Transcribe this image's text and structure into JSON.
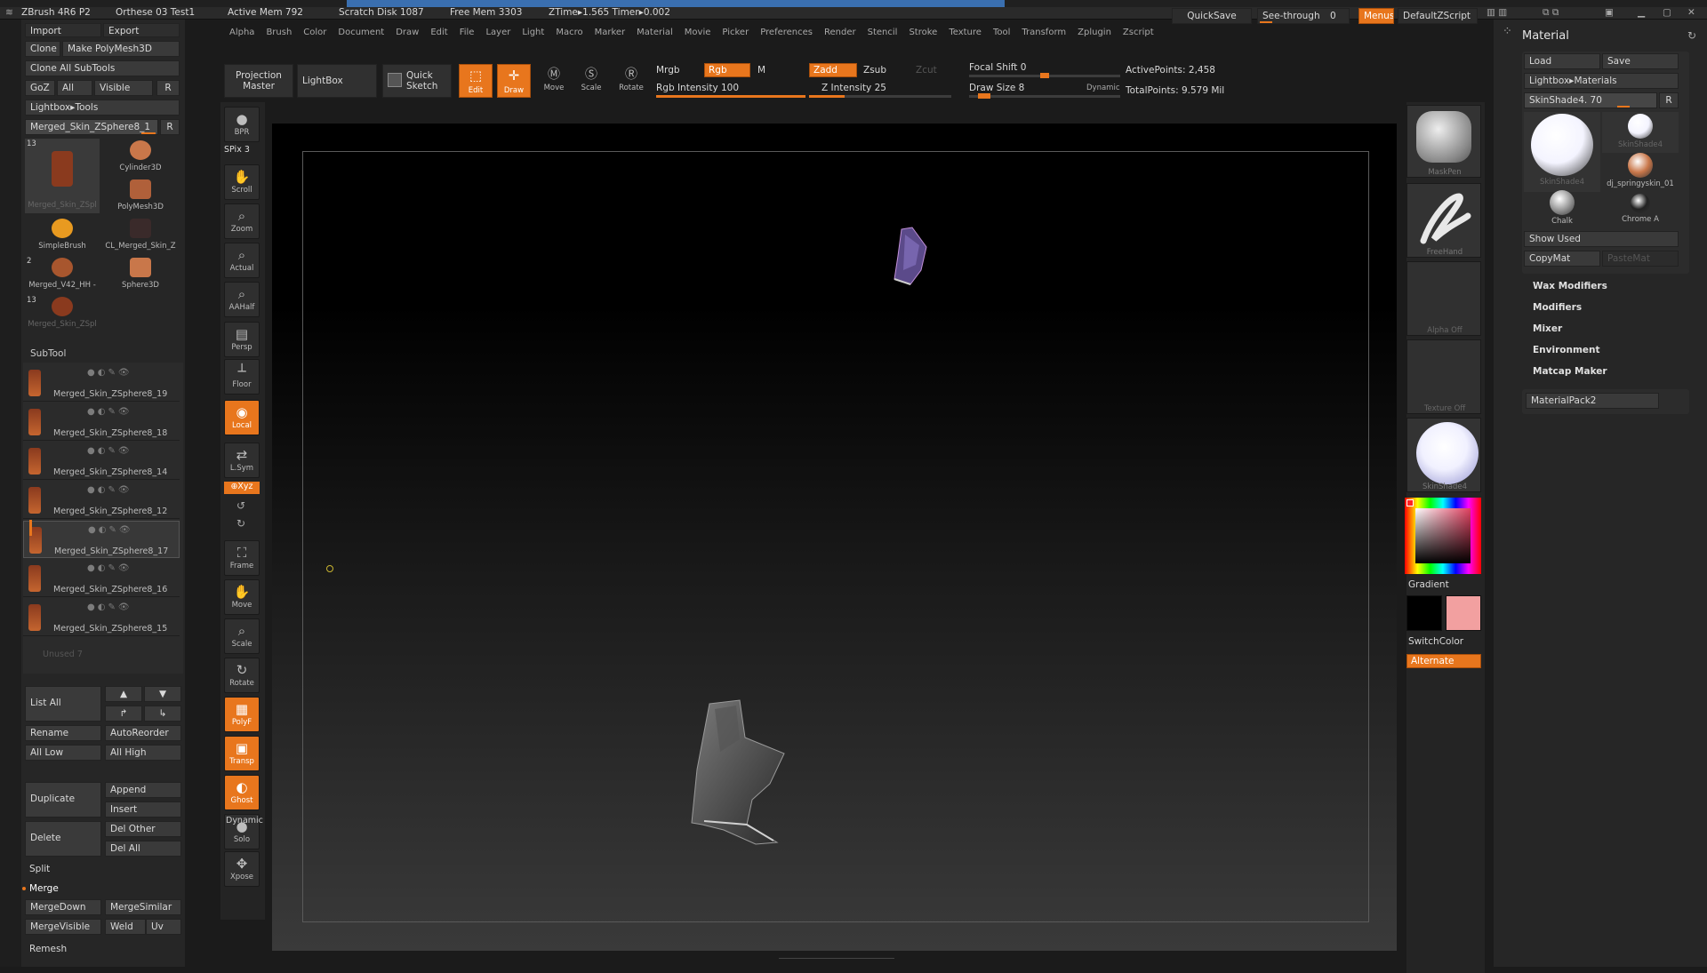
{
  "titlebar": {
    "app": "ZBrush 4R6 P2",
    "document": "Orthese 03 Test1",
    "active_mem": "Active Mem 792",
    "scratch_disk": "Scratch Disk 1087",
    "free_mem": "Free Mem 3303",
    "ztime": "ZTime▸1.565 Timer▸0.002",
    "quicksave": "QuickSave",
    "see_through": "See-through",
    "see_through_value": "0",
    "menus": "Menus",
    "script": "DefaultZScript"
  },
  "menubar": [
    "Alpha",
    "Brush",
    "Color",
    "Document",
    "Draw",
    "Edit",
    "File",
    "Layer",
    "Light",
    "Macro",
    "Marker",
    "Material",
    "Movie",
    "Picker",
    "Preferences",
    "Render",
    "Stencil",
    "Stroke",
    "Texture",
    "Tool",
    "Transform",
    "Zplugin",
    "Zscript"
  ],
  "tool_panel": {
    "import": "Import",
    "export": "Export",
    "clone": "Clone",
    "make_polymesh": "Make PolyMesh3D",
    "clone_all": "Clone All SubTools",
    "goz": "GoZ",
    "all": "All",
    "visible": "Visible",
    "r": "R",
    "lightbox_tools": "Lightbox▸Tools",
    "current_tool": "Merged_Skin_ZSphere8_1",
    "current_r": "R",
    "tools": [
      {
        "name": "Merged_Skin_ZSpl",
        "badge": "13"
      },
      {
        "name": "Cylinder3D",
        "badge": ""
      },
      {
        "name": "PolyMesh3D",
        "badge": ""
      },
      {
        "name": "SimpleBrush",
        "badge": ""
      },
      {
        "name": "CL_Merged_Skin_Z",
        "badge": ""
      },
      {
        "name": "Merged_V42_HH -",
        "badge": "2"
      },
      {
        "name": "Sphere3D",
        "badge": ""
      },
      {
        "name": "Merged_Skin_ZSpl",
        "badge": "13"
      }
    ]
  },
  "subtool": {
    "header": "SubTool",
    "items": [
      "Merged_Skin_ZSphere8_19",
      "Merged_Skin_ZSphere8_18",
      "Merged_Skin_ZSphere8_14",
      "Merged_Skin_ZSphere8_12",
      "Merged_Skin_ZSphere8_17",
      "Merged_Skin_ZSphere8_16",
      "Merged_Skin_ZSphere8_15"
    ],
    "unused": "Unused 7",
    "list_all": "List All",
    "rename": "Rename",
    "autoreorder": "AutoReorder",
    "all_low": "All Low",
    "all_high": "All High",
    "duplicate": "Duplicate",
    "append": "Append",
    "insert": "Insert",
    "delete": "Delete",
    "del_other": "Del Other",
    "del_all": "Del All",
    "split": "Split",
    "merge": "Merge",
    "mergedown": "MergeDown",
    "mergesimilar": "MergeSimilar",
    "mergevisible": "MergeVisible",
    "weld": "Weld",
    "uv": "Uv",
    "remesh": "Remesh"
  },
  "toolbar": {
    "projection_master": "Projection Master",
    "lightbox": "LightBox",
    "quick_sketch": "Quick Sketch",
    "edit": "Edit",
    "draw": "Draw",
    "move": "Move",
    "scale": "Scale",
    "rotate": "Rotate",
    "mrgb": "Mrgb",
    "rgb": "Rgb",
    "m": "M",
    "rgb_intensity": "Rgb Intensity 100",
    "rgb_intensity_value": 100,
    "zadd": "Zadd",
    "zsub": "Zsub",
    "zcut": "Zcut",
    "z_intensity": "Z Intensity 25",
    "z_intensity_value": 25,
    "focal_shift": "Focal Shift 0",
    "focal_shift_value": 0,
    "draw_size": "Draw Size 8",
    "draw_size_value": 8,
    "dynamic": "Dynamic",
    "active_points": "ActivePoints: 2,458",
    "total_points": "TotalPoints: 9.579 Mil"
  },
  "left_shelf": [
    {
      "name": "BPR",
      "glyph": "●",
      "on": false
    },
    {
      "name": "Scroll",
      "glyph": "✋",
      "on": false
    },
    {
      "name": "Zoom",
      "glyph": "⌕",
      "on": false
    },
    {
      "name": "Actual",
      "glyph": "⌕",
      "on": false
    },
    {
      "name": "AAHalf",
      "glyph": "⌕",
      "on": false
    },
    {
      "name": "Persp",
      "glyph": "▤",
      "on": false
    },
    {
      "name": "Floor",
      "glyph": "┴",
      "on": false
    },
    {
      "name": "Local",
      "glyph": "◉",
      "on": true
    },
    {
      "name": "L.Sym",
      "glyph": "⇄",
      "on": false
    },
    {
      "name": "Frame",
      "glyph": "⛶",
      "on": false
    },
    {
      "name": "Move",
      "glyph": "✋",
      "on": false
    },
    {
      "name": "Scale",
      "glyph": "⌕",
      "on": false
    },
    {
      "name": "Rotate",
      "glyph": "↻",
      "on": false
    },
    {
      "name": "PolyF",
      "glyph": "▦",
      "on": true
    },
    {
      "name": "Transp",
      "glyph": "▣",
      "on": true
    },
    {
      "name": "Ghost",
      "glyph": "◐",
      "on": true
    },
    {
      "name": "Solo",
      "glyph": "●",
      "on": false
    },
    {
      "name": "Xpose",
      "glyph": "✥",
      "on": false
    }
  ],
  "left_shelf_extra": {
    "spix": "SPix 3",
    "xyz": "⊕Xyz",
    "dynamic": "Dynamic"
  },
  "right_shelf": {
    "brush": "MaskPen",
    "stroke": "FreeHand",
    "alpha": "Alpha  Off",
    "texture": "Texture  Off",
    "material": "SkinShade4",
    "gradient": "Gradient",
    "switchcolor": "SwitchColor",
    "alternate": "Alternate",
    "main_color": "#000000",
    "secondary_color": "#f2a0a0"
  },
  "material_panel": {
    "title": "Material",
    "load": "Load",
    "save": "Save",
    "lightbox_materials": "Lightbox▸Materials",
    "current": "SkinShade4. 70",
    "r": "R",
    "materials": [
      {
        "name": "SkinShade4",
        "color": "#f4f4ff"
      },
      {
        "name": "SkinShade4",
        "color": "#f4f4ff"
      },
      {
        "name": "dj_springyskin_01",
        "color": "#c9774a"
      },
      {
        "name": "Chalk",
        "color": "#9a9a9a"
      },
      {
        "name": "Chrome A",
        "color": "#222222"
      }
    ],
    "show_used": "Show Used",
    "copymat": "CopyMat",
    "pastemat": "PasteMat",
    "sections": [
      "Wax Modifiers",
      "Modifiers",
      "Mixer",
      "Environment",
      "Matcap Maker"
    ],
    "pack": "MaterialPack2"
  }
}
